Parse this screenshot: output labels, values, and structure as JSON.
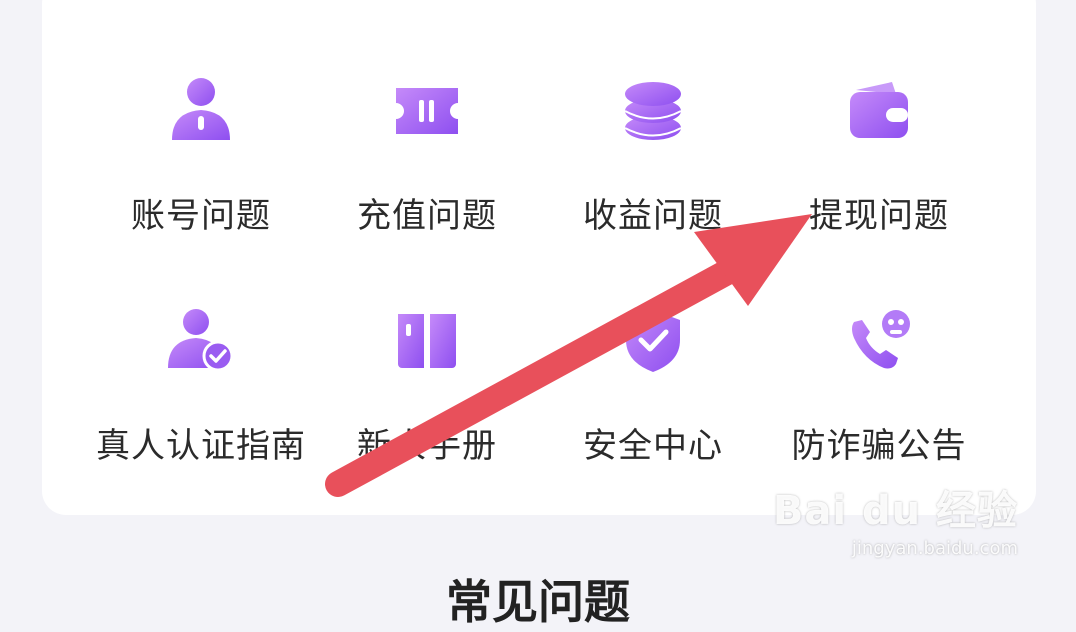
{
  "grid": {
    "items": [
      {
        "label": "账号问题",
        "icon": "user-icon"
      },
      {
        "label": "充值问题",
        "icon": "ticket-icon"
      },
      {
        "label": "收益问题",
        "icon": "coin-stack-icon"
      },
      {
        "label": "提现问题",
        "icon": "wallet-icon"
      },
      {
        "label": "真人认证指南",
        "icon": "verified-user-icon"
      },
      {
        "label": "新人手册",
        "icon": "book-icon"
      },
      {
        "label": "安全中心",
        "icon": "shield-icon"
      },
      {
        "label": "防诈骗公告",
        "icon": "phone-alert-icon"
      }
    ]
  },
  "section_heading": "常见问题",
  "annotation": {
    "arrow_color": "#e8505b"
  },
  "watermark": {
    "logo": "Bai du 经验",
    "url": "jingyan.baidu.com"
  },
  "colors": {
    "icon_purple": "#a463f2",
    "text": "#2b2b2b"
  }
}
